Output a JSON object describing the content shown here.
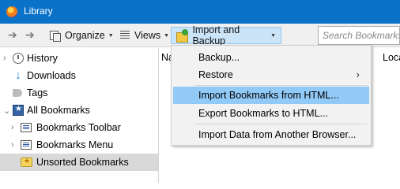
{
  "window": {
    "title": "Library"
  },
  "toolbar": {
    "organize_label": "Organize",
    "views_label": "Views",
    "import_backup_label": "Import and Backup",
    "search_placeholder": "Search Bookmarks"
  },
  "sidebar": {
    "items": [
      {
        "label": "History",
        "icon": "history-icon"
      },
      {
        "label": "Downloads",
        "icon": "download-icon"
      },
      {
        "label": "Tags",
        "icon": "tag-icon"
      },
      {
        "label": "All Bookmarks",
        "icon": "bookmarks-icon"
      },
      {
        "label": "Bookmarks Toolbar",
        "icon": "bookmarks-toolbar-icon"
      },
      {
        "label": "Bookmarks Menu",
        "icon": "bookmarks-menu-icon"
      },
      {
        "label": "Unsorted Bookmarks",
        "icon": "unsorted-bookmarks-icon",
        "selected": true
      }
    ]
  },
  "content": {
    "columns": [
      "Na",
      "Loca"
    ]
  },
  "menu": {
    "items": [
      {
        "label": "Backup..."
      },
      {
        "label": "Restore",
        "submenu": true
      },
      {
        "label": "Import Bookmarks from HTML...",
        "highlighted": true
      },
      {
        "label": "Export Bookmarks to HTML..."
      },
      {
        "label": "Import Data from Another Browser..."
      }
    ]
  }
}
